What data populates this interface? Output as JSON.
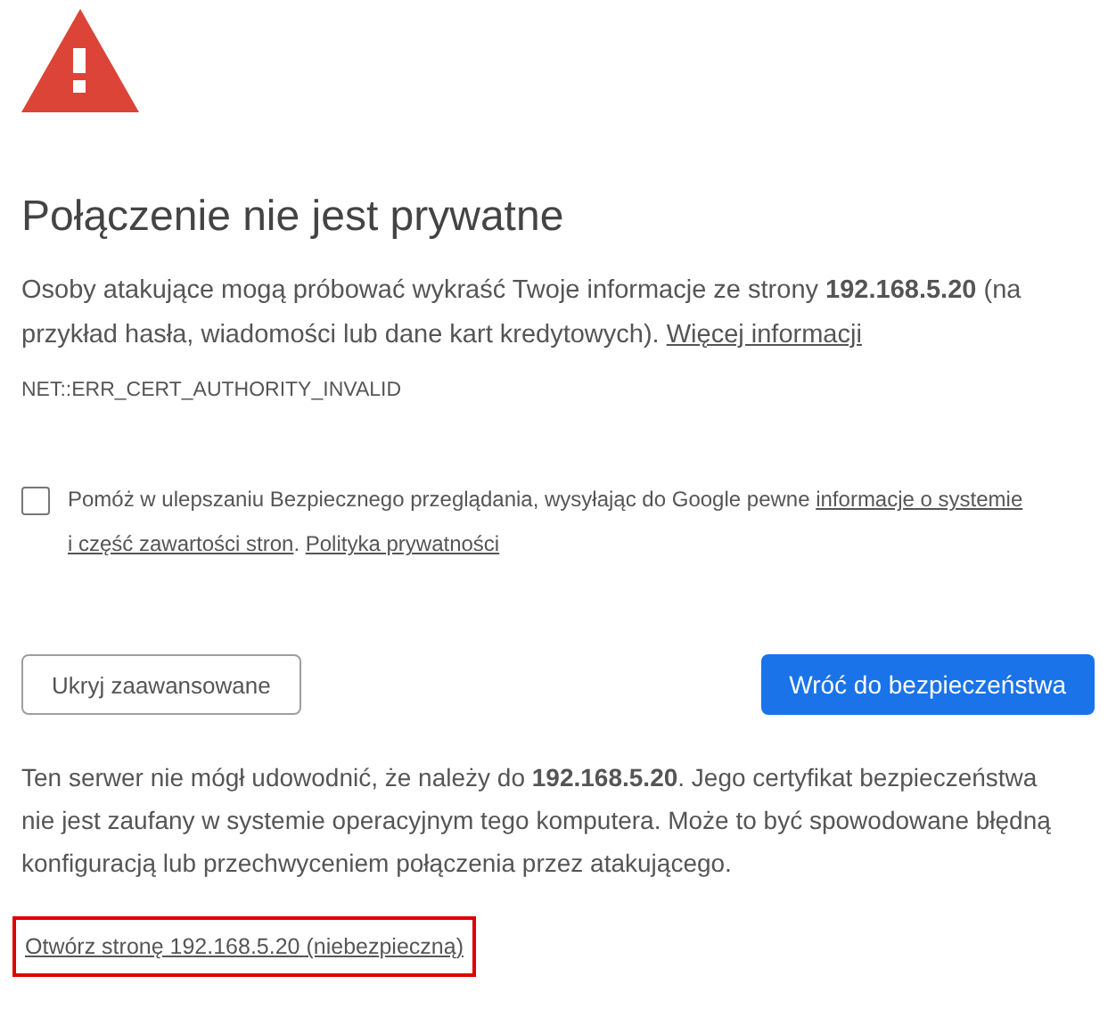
{
  "title": "Połączenie nie jest prywatne",
  "intro": [
    {
      "kind": "text",
      "text": "Osoby atakujące mogą próbować wykraść Twoje informacje ze strony **192.168.5.20** (na przykład hasła, wiadomości lub dane kart kredytowych). "
    },
    {
      "kind": "link",
      "text": "Więcej informacji"
    }
  ],
  "error_code": "NET::ERR_CERT_AUTHORITY_INVALID",
  "report": {
    "checked": false,
    "parts": [
      {
        "kind": "text",
        "text": "Pomóż w ulepszaniu Bezpiecznego przeglądania, wysyłając do Google pewne "
      },
      {
        "kind": "link",
        "text": "informacje o systemie"
      },
      {
        "kind": "link",
        "text": "i część zawartości stron"
      },
      {
        "kind": "text",
        "text": ". "
      },
      {
        "kind": "link",
        "text": "Polityka prywatności"
      }
    ]
  },
  "buttons": [
    {
      "kind": "secondary",
      "label": "Ukryj zaawansowane"
    },
    {
      "kind": "primary",
      "label": "Wróć do bezpieczeństwa"
    }
  ],
  "details": "Ten serwer nie mógł udowodnić, że należy do **192.168.5.20**. Jego certyfikat bezpieczeństwa nie jest zaufany w systemie operacyjnym tego komputera. Może to być spowodowane błędną konfiguracją lub przechwyceniem połączenia przez atakującego.",
  "proceed_link": {
    "text": "Otwórz stronę 192.168.5.20 (niebezpieczną)",
    "highlighted": true
  }
}
